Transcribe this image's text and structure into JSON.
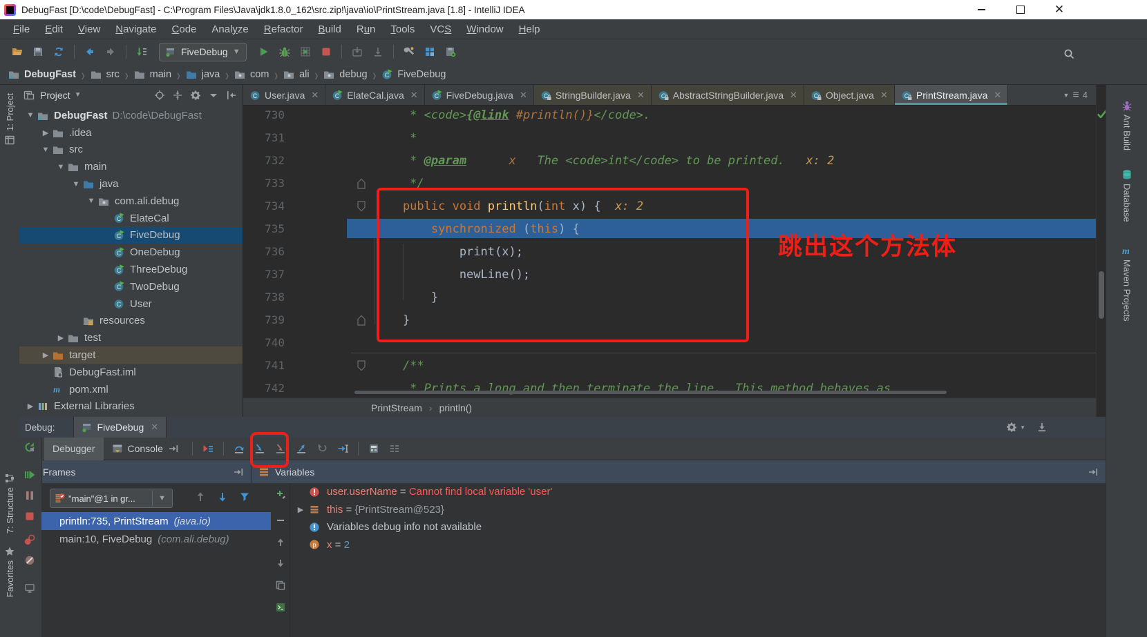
{
  "window": {
    "title": "DebugFast [D:\\code\\DebugFast] - C:\\Program Files\\Java\\jdk1.8.0_162\\src.zip!\\java\\io\\PrintStream.java [1.8] - IntelliJ IDEA"
  },
  "menu": {
    "items": [
      {
        "pre": "",
        "mn": "F",
        "post": "ile"
      },
      {
        "pre": "",
        "mn": "E",
        "post": "dit"
      },
      {
        "pre": "",
        "mn": "V",
        "post": "iew"
      },
      {
        "pre": "",
        "mn": "N",
        "post": "avigate"
      },
      {
        "pre": "",
        "mn": "C",
        "post": "ode"
      },
      {
        "pre": "Anal",
        "mn": "y",
        "post": "ze"
      },
      {
        "pre": "",
        "mn": "R",
        "post": "efactor"
      },
      {
        "pre": "",
        "mn": "B",
        "post": "uild"
      },
      {
        "pre": "R",
        "mn": "u",
        "post": "n"
      },
      {
        "pre": "",
        "mn": "T",
        "post": "ools"
      },
      {
        "pre": "VC",
        "mn": "S",
        "post": ""
      },
      {
        "pre": "",
        "mn": "W",
        "post": "indow"
      },
      {
        "pre": "",
        "mn": "H",
        "post": "elp"
      }
    ]
  },
  "toolbar": {
    "run_config": "FiveDebug",
    "icons_group1": [
      "open-icon",
      "save-icon",
      "sync-icon",
      "|",
      "back-icon",
      "forward-icon",
      "|",
      "line-numbers-icon"
    ],
    "icons_group2": [
      "run-icon",
      "debug-icon",
      "coverage-icon",
      "stop-icon",
      "|",
      "update-app-icon",
      "dump-icon",
      "|",
      "wrench-icon",
      "structure-grid-icon",
      "patch-icon"
    ],
    "icons_right": [
      "search-icon"
    ]
  },
  "breadcrumbs": {
    "items": [
      {
        "label": "DebugFast",
        "icon": "module-folder-icon"
      },
      {
        "label": "src",
        "icon": "folder-icon"
      },
      {
        "label": "main",
        "icon": "folder-icon"
      },
      {
        "label": "java",
        "icon": "folder-blue-icon"
      },
      {
        "label": "com",
        "icon": "package-icon"
      },
      {
        "label": "ali",
        "icon": "package-icon"
      },
      {
        "label": "debug",
        "icon": "package-icon"
      },
      {
        "label": "FiveDebug",
        "icon": "class-run-icon"
      }
    ]
  },
  "left_stripe": {
    "top": "1: Project",
    "middle": "7: Structure",
    "bottom": "Favorites"
  },
  "right_stripe": {
    "items": [
      {
        "label": "Ant Build",
        "icon": "ant-icon"
      },
      {
        "label": "Database",
        "icon": "database-icon"
      },
      {
        "label": "Maven Projects",
        "icon": "maven-icon"
      }
    ]
  },
  "project": {
    "title": "Project",
    "header_icons": [
      "locate-icon",
      "collapse-all-icon",
      "gear-icon",
      "combo-arrow",
      "hide-stripe-icon"
    ],
    "items": [
      {
        "depth": 0,
        "arrow": "down",
        "icon": "module-folder-icon",
        "label": "DebugFast",
        "suffix": " D:\\code\\DebugFast",
        "bold": true
      },
      {
        "depth": 1,
        "arrow": "right",
        "icon": "folder-icon",
        "label": ".idea"
      },
      {
        "depth": 1,
        "arrow": "down",
        "icon": "folder-icon",
        "label": "src"
      },
      {
        "depth": 2,
        "arrow": "down",
        "icon": "folder-icon",
        "label": "main"
      },
      {
        "depth": 3,
        "arrow": "down",
        "icon": "folder-blue-icon",
        "label": "java"
      },
      {
        "depth": 4,
        "arrow": "down",
        "icon": "package-icon",
        "label": "com.ali.debug"
      },
      {
        "depth": 5,
        "arrow": "",
        "icon": "class-run-icon",
        "label": "ElateCal"
      },
      {
        "depth": 5,
        "arrow": "",
        "icon": "class-run-icon",
        "label": "FiveDebug",
        "state": "selected"
      },
      {
        "depth": 5,
        "arrow": "",
        "icon": "class-run-icon",
        "label": "OneDebug"
      },
      {
        "depth": 5,
        "arrow": "",
        "icon": "class-run-icon",
        "label": "ThreeDebug"
      },
      {
        "depth": 5,
        "arrow": "",
        "icon": "class-run-icon",
        "label": "TwoDebug"
      },
      {
        "depth": 5,
        "arrow": "",
        "icon": "class-icon",
        "label": "User"
      },
      {
        "depth": 3,
        "arrow": "",
        "icon": "folder-resources-icon",
        "label": "resources"
      },
      {
        "depth": 2,
        "arrow": "right",
        "icon": "folder-icon",
        "label": "test"
      },
      {
        "depth": 1,
        "arrow": "right",
        "icon": "folder-excluded-icon",
        "label": "target",
        "state": "soft"
      },
      {
        "depth": 1,
        "arrow": "",
        "icon": "file-iml-icon",
        "label": "DebugFast.iml"
      },
      {
        "depth": 1,
        "arrow": "",
        "icon": "file-maven-icon",
        "label": "pom.xml"
      },
      {
        "depth": 0,
        "arrow": "right",
        "icon": "libraries-icon",
        "label": "External Libraries"
      }
    ]
  },
  "tabs": {
    "overflow_count": "4",
    "items": [
      {
        "label": "User.java",
        "icon": "class-icon"
      },
      {
        "label": "ElateCal.java",
        "icon": "class-run-icon"
      },
      {
        "label": "FiveDebug.java",
        "icon": "class-run-icon"
      },
      {
        "label": "StringBuilder.java",
        "icon": "class-lock-icon",
        "lib": true
      },
      {
        "label": "AbstractStringBuilder.java",
        "icon": "class-abstract-lock-icon",
        "lib": true
      },
      {
        "label": "Object.java",
        "icon": "class-lock-icon",
        "lib": true
      },
      {
        "label": "PrintStream.java",
        "icon": "class-lock-icon",
        "lib": true,
        "active": true
      }
    ]
  },
  "editor": {
    "breadcrumb": {
      "0": "PrintStream",
      "1": "println()"
    },
    "annotation": "跳出这个方法体",
    "code": {
      "lines": [
        {
          "n": 730,
          "tokens": [
            [
              "doc",
              "     * <code>"
            ],
            [
              "doclink",
              "{@link"
            ],
            [
              "docval",
              " #println()}"
            ],
            [
              "doc",
              "</code>."
            ]
          ]
        },
        {
          "n": 731,
          "tokens": [
            [
              "doc",
              "     *"
            ]
          ]
        },
        {
          "n": 732,
          "tokens": [
            [
              "doc",
              "     * "
            ],
            [
              "doclink",
              "@param"
            ],
            [
              "docval",
              "      x"
            ],
            [
              "doc",
              "   The <code>int</code> to be printed."
            ],
            [
              "hint",
              "   x: 2"
            ]
          ]
        },
        {
          "n": 733,
          "fold": "up",
          "tokens": [
            [
              "doc",
              "     */"
            ]
          ]
        },
        {
          "n": 734,
          "fold": "down",
          "tokens": [
            [
              "kw",
              "    public void "
            ],
            [
              "method",
              "println"
            ],
            [
              "plain",
              "("
            ],
            [
              "kw",
              "int"
            ],
            [
              "plain",
              " x) {  "
            ],
            [
              "hint",
              "x: 2"
            ]
          ]
        },
        {
          "n": 735,
          "exec": true,
          "tokens": [
            [
              "kw",
              "        synchronized "
            ],
            [
              "plain",
              "("
            ],
            [
              "kw",
              "this"
            ],
            [
              "plain",
              ") {"
            ]
          ]
        },
        {
          "n": 736,
          "tokens": [
            [
              "plain",
              "            print(x);"
            ]
          ]
        },
        {
          "n": 737,
          "tokens": [
            [
              "plain",
              "            newLine();"
            ]
          ]
        },
        {
          "n": 738,
          "tokens": [
            [
              "plain",
              "        }"
            ]
          ]
        },
        {
          "n": 739,
          "fold": "up",
          "tokens": [
            [
              "plain",
              "    }"
            ]
          ]
        },
        {
          "n": 740,
          "tokens": []
        },
        {
          "n": 741,
          "fold": "down",
          "tokens": [
            [
              "doc",
              "    /**"
            ]
          ]
        },
        {
          "n": 742,
          "tokens": [
            [
              "doc",
              "     * Prints a long and then terminate the line.  This method behaves as"
            ]
          ]
        }
      ]
    }
  },
  "debug": {
    "label": "Debug:",
    "session": {
      "name": "FiveDebug"
    },
    "tool_tabs": [
      {
        "label": "Debugger",
        "active": true,
        "icon": ""
      },
      {
        "label": "Console",
        "icon": "console-icon",
        "pin": true
      }
    ],
    "step_icons": [
      "show-execution-point-icon",
      "|",
      "step-over-icon",
      "step-into-icon",
      "force-step-into-icon",
      "step-out-icon",
      "drop-frame-icon",
      "run-to-cursor-icon",
      "|",
      "evaluate-icon",
      "layout-icon"
    ],
    "right_icons_tabrow": [
      "gear-icon",
      "hide-icon"
    ],
    "right_icons_toolbar": [
      "threads-icon",
      "lens-icon",
      "gauge-icon"
    ],
    "rail_icons": [
      "rerun-icon",
      "resume-icon",
      "pause-icon",
      "stop-debug-icon",
      "view-breakpoints-icon",
      "mute-breakpoints-icon",
      "monitor-icon"
    ],
    "watch_icons": [
      "add-watch-icon",
      "remove-watch-icon",
      "move-up-icon",
      "move-down-icon",
      "copy-icon",
      "terminal-icon"
    ],
    "frames": {
      "title": "Frames",
      "thread": "\"main\"@1 in gr...",
      "items": [
        {
          "location": "println:735, PrintStream",
          "package": "(java.io)",
          "selected": true
        },
        {
          "location": "main:10, FiveDebug",
          "package": "(com.ali.debug)",
          "selected": false
        }
      ]
    },
    "variables": {
      "title": "Variables",
      "items": [
        {
          "icon": "var-error-icon",
          "arrow": "",
          "name": "user.userName",
          "eq": " = ",
          "value": "Cannot find local variable 'user'",
          "kind": "error"
        },
        {
          "icon": "var-object-icon",
          "arrow": "right",
          "name": "this",
          "eq": " = ",
          "value": "{PrintStream@523}",
          "kind": "ref"
        },
        {
          "icon": "var-info-icon",
          "arrow": "",
          "name": "",
          "eq": "",
          "value": "Variables debug info not available",
          "kind": "info"
        },
        {
          "icon": "var-param-icon",
          "arrow": "",
          "name": "x",
          "eq": " = ",
          "value": "2",
          "kind": "num"
        }
      ]
    }
  },
  "colors": {
    "annotation_red": "#ee1f16",
    "execution_line": "#2d6099",
    "tree_selection": "#164a73",
    "frame_selection": "#3c64ac",
    "tab_underline": "#4a9b9b",
    "error_text": "#ff5b55",
    "panel_bg": "#3c3f41",
    "editor_bg": "#2b2b2b"
  }
}
